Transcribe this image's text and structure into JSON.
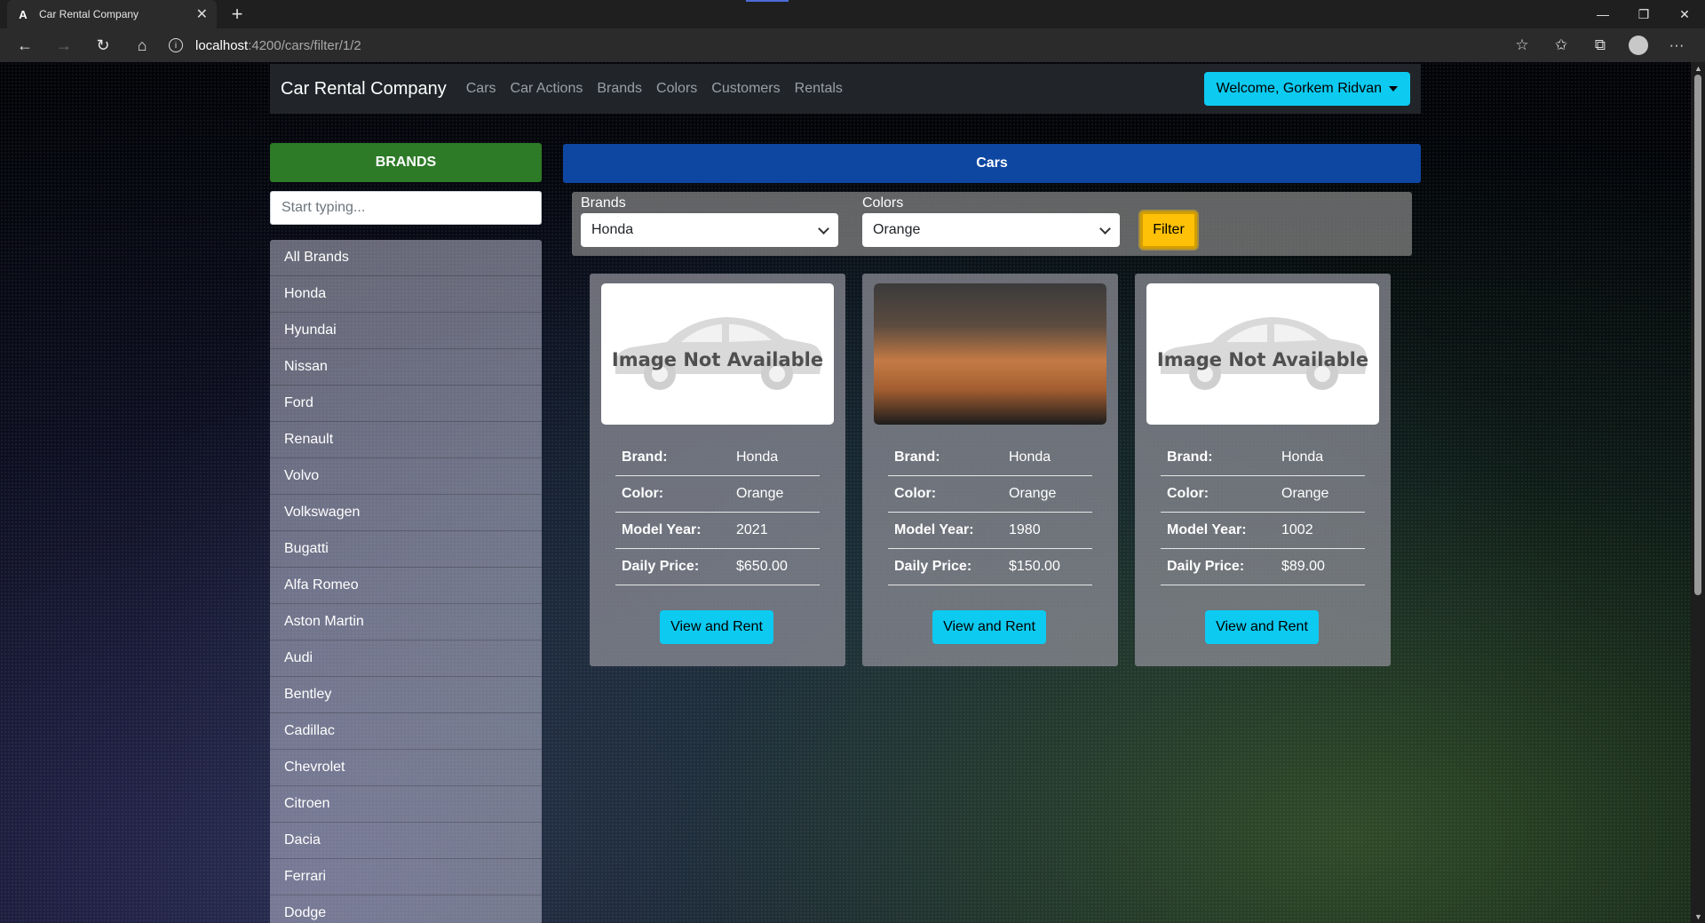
{
  "browser": {
    "tab_title": "Car Rental Company",
    "tab_favicon": "A",
    "url_host": "localhost",
    "url_rest": ":4200/cars/filter/1/2"
  },
  "navbar": {
    "brand": "Car Rental Company",
    "links": [
      "Cars",
      "Car Actions",
      "Brands",
      "Colors",
      "Customers",
      "Rentals"
    ],
    "welcome": "Welcome, Gorkem Ridvan"
  },
  "sidebar": {
    "header": "BRANDS",
    "search_placeholder": "Start typing...",
    "items": [
      "All Brands",
      "Honda",
      "Hyundai",
      "Nissan",
      "Ford",
      "Renault",
      "Volvo",
      "Volkswagen",
      "Bugatti",
      "Alfa Romeo",
      "Aston Martin",
      "Audi",
      "Bentley",
      "Cadillac",
      "Chevrolet",
      "Citroen",
      "Dacia",
      "Ferrari",
      "Dodge"
    ]
  },
  "main": {
    "header": "Cars",
    "filter": {
      "brands_label": "Brands",
      "brands_value": "Honda",
      "colors_label": "Colors",
      "colors_value": "Orange",
      "button": "Filter"
    },
    "labels": {
      "brand": "Brand:",
      "color": "Color:",
      "model_year": "Model Year:",
      "daily_price": "Daily Price:",
      "rent": "View and Rent",
      "image_na": "Image Not Available"
    },
    "cars": [
      {
        "brand": "Honda",
        "color": "Orange",
        "model_year": "2021",
        "daily_price": "$650.00",
        "has_image": false
      },
      {
        "brand": "Honda",
        "color": "Orange",
        "model_year": "1980",
        "daily_price": "$150.00",
        "has_image": true
      },
      {
        "brand": "Honda",
        "color": "Orange",
        "model_year": "1002",
        "daily_price": "$89.00",
        "has_image": false
      }
    ]
  },
  "colors": {
    "brands_header": "#2d7a27",
    "cars_header": "#0d47a1",
    "accent_button": "#0dcaf0",
    "filter_button": "#ffc107"
  }
}
